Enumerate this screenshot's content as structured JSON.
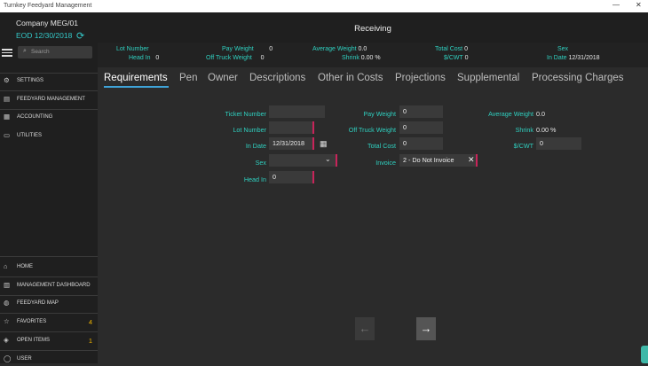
{
  "window": {
    "title": "Turnkey Feedyard Management",
    "minimize": "—",
    "close": "✕"
  },
  "sidebar": {
    "company": "Company MEG/01",
    "eod": "EOD 12/30/2018",
    "search_placeholder": "Search",
    "top_items": [
      {
        "label": "SETTINGS",
        "icon": "gear-icon"
      },
      {
        "label": "FEEDYARD MANAGEMENT",
        "icon": "feedyard-icon"
      },
      {
        "label": "ACCOUNTING",
        "icon": "calculator-icon"
      },
      {
        "label": "UTILITIES",
        "icon": "monitor-icon"
      }
    ],
    "bottom_items": [
      {
        "label": "HOME",
        "icon": "home-icon",
        "badge": ""
      },
      {
        "label": "MANAGEMENT DASHBOARD",
        "icon": "dashboard-icon",
        "badge": ""
      },
      {
        "label": "FEEDYARD MAP",
        "icon": "globe-icon",
        "badge": ""
      },
      {
        "label": "FAVORITES",
        "icon": "star-icon",
        "badge": "4"
      },
      {
        "label": "OPEN ITEMS",
        "icon": "layers-icon",
        "badge": "1"
      },
      {
        "label": "USER",
        "icon": "user-icon",
        "badge": ""
      }
    ]
  },
  "header": {
    "title": "Receiving"
  },
  "info": {
    "lot_number_label": "Lot Number",
    "lot_number": "",
    "head_in_label": "Head In",
    "head_in": "0",
    "pay_weight_label": "Pay Weight",
    "pay_weight": "0",
    "off_truck_label": "Off Truck Weight",
    "off_truck": "0",
    "avg_weight_label": "Average Weight",
    "avg_weight": "0.0",
    "shrink_label": "Shrink",
    "shrink": "0.00  %",
    "total_cost_label": "Total Cost",
    "total_cost": "0",
    "cwt_label": "$/CWT",
    "cwt": "0",
    "sex_label": "Sex",
    "sex": "",
    "in_date_label": "In Date",
    "in_date": "12/31/2018"
  },
  "tabs": [
    "Requirements",
    "Pen",
    "Owner",
    "Descriptions",
    "Other in Costs",
    "Projections",
    "Supplemental",
    "Processing Charges"
  ],
  "form": {
    "ticket_number_label": "Ticket Number",
    "ticket_number": "",
    "lot_number_label": "Lot Number",
    "lot_number": "",
    "in_date_label": "In Date",
    "in_date": "12/31/2018",
    "sex_label": "Sex",
    "sex": "",
    "head_in_label": "Head In",
    "head_in": "0",
    "pay_weight_label": "Pay Weight",
    "pay_weight": "0",
    "off_truck_label": "Off Truck Weight",
    "off_truck": "0",
    "total_cost_label": "Total Cost",
    "total_cost": "0",
    "invoice_label": "Invoice",
    "invoice": "2 - Do Not Invoice",
    "avg_weight_label": "Average Weight",
    "avg_weight": "0.0",
    "shrink_label": "Shrink",
    "shrink": "0.00  %",
    "cwt_label": "$/CWT",
    "cwt": "0"
  },
  "nav": {
    "prev": "←",
    "next": "→"
  },
  "colors": {
    "accent": "#2fd0c0",
    "tab_underline": "#3fa3d8",
    "required": "#c8245a",
    "badge": "#f0b400"
  }
}
